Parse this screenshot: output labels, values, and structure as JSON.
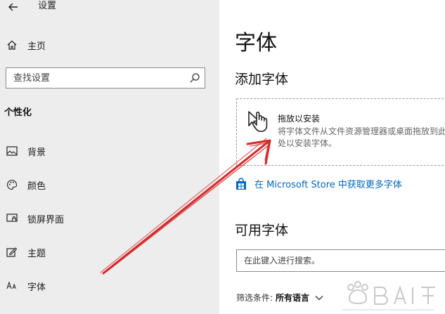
{
  "window": {
    "title": "设置",
    "back_icon": "back-arrow-icon"
  },
  "sidebar": {
    "home_label": "主页",
    "search_placeholder": "查找设置",
    "section_label": "个性化",
    "items": [
      {
        "label": "背景",
        "icon": "image-icon"
      },
      {
        "label": "颜色",
        "icon": "palette-icon"
      },
      {
        "label": "锁屏界面",
        "icon": "lock-screen-icon"
      },
      {
        "label": "主题",
        "icon": "theme-icon"
      },
      {
        "label": "字体",
        "icon": "font-icon"
      }
    ]
  },
  "main": {
    "title": "字体",
    "add_heading": "添加字体",
    "drop_title": "拖放以安装",
    "drop_desc": "将字体文件从文件资源管理器或桌面拖放到此处以安装字体。",
    "store_link": "在 Microsoft Store 中获取更多字体",
    "available_heading": "可用字体",
    "font_search_placeholder": "在此键入进行搜索。",
    "filter_label": "筛选条件:",
    "filter_value": "所有语言"
  },
  "colors": {
    "accent": "#0067c0",
    "arrow": "#d42a2a",
    "sidebar_bg": "#ededed"
  }
}
